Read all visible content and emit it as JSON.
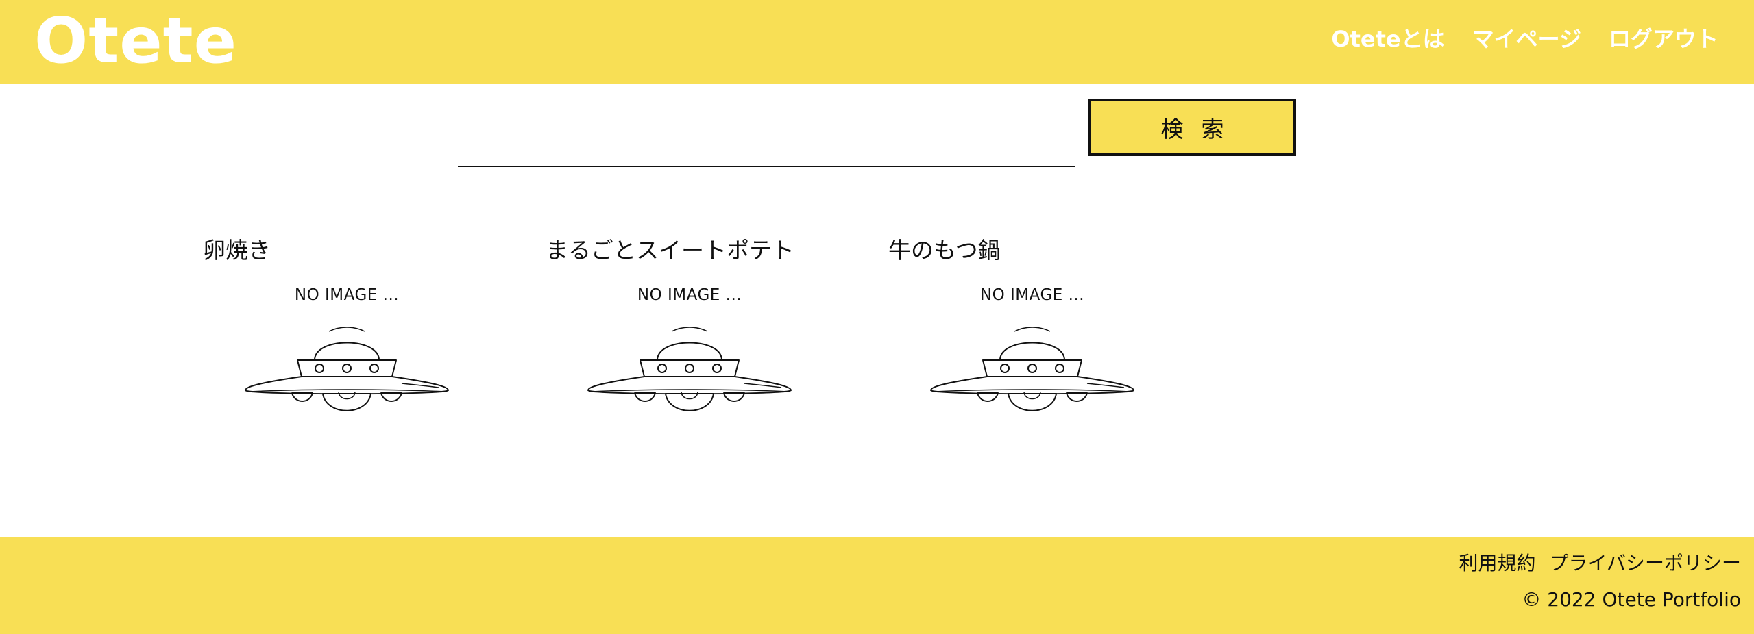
{
  "header": {
    "logo": "Otete",
    "nav": [
      {
        "label": "Oteteとは"
      },
      {
        "label": "マイページ"
      },
      {
        "label": "ログアウト"
      }
    ]
  },
  "search": {
    "value": "",
    "placeholder": "",
    "button_label": "検索"
  },
  "cards": [
    {
      "title": "卵焼き",
      "image_text": "NO IMAGE ..."
    },
    {
      "title": "まるごとスイートポテト",
      "image_text": "NO IMAGE ..."
    },
    {
      "title": "牛のもつ鍋",
      "image_text": "NO IMAGE ..."
    }
  ],
  "footer": {
    "links": [
      {
        "label": "利用規約"
      },
      {
        "label": "プライバシーポリシー"
      }
    ],
    "copyright": "© 2022 Otete Portfolio"
  },
  "colors": {
    "brand_yellow": "#f8df55",
    "text": "#111111",
    "logo_text": "#ffffff"
  },
  "icons": {
    "placeholder_image": "ufo-icon"
  }
}
